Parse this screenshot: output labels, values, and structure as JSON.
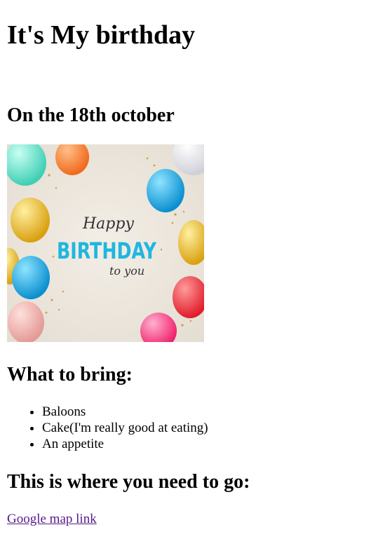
{
  "page": {
    "title": "It's My birthday",
    "date_heading": "On the 18th october",
    "banner": {
      "line1": "Happy",
      "line2": "BIRTHDAY",
      "line3": "to you"
    },
    "bring_heading": "What to bring:",
    "bring_items": [
      "Baloons",
      "Cake(I'm really good at eating)",
      "An appetite"
    ],
    "where_heading": "This is where you need to go:",
    "map_link": "Google map link"
  },
  "colors": {
    "link_visited": "#551a8b",
    "banner_text": "#1fb6e0"
  }
}
